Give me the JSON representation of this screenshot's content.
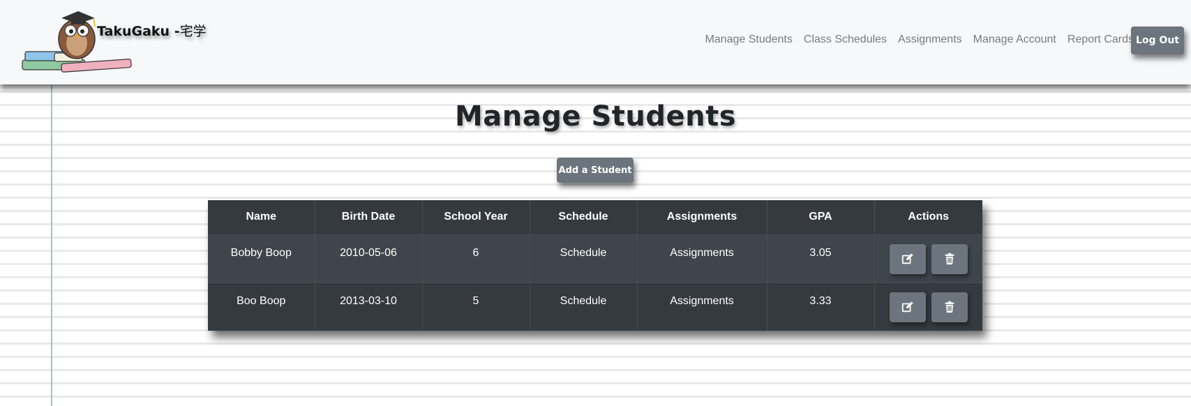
{
  "navbar": {
    "brand_main": "TakuGaku -",
    "brand_jp": "宅学",
    "links": [
      "Manage Students",
      "Class Schedules",
      "Assignments",
      "Manage Account",
      "Report Cards"
    ],
    "logout_label": "Log Out"
  },
  "page": {
    "title": "Manage Students",
    "add_button": "Add a Student"
  },
  "table": {
    "headers": [
      "Name",
      "Birth Date",
      "School Year",
      "Schedule",
      "Assignments",
      "GPA",
      "Actions"
    ],
    "rows": [
      {
        "name": "Bobby Boop",
        "birth_date": "2010-05-06",
        "school_year": "6",
        "schedule": "Schedule",
        "assignments": "Assignments",
        "gpa": "3.05"
      },
      {
        "name": "Boo Boop",
        "birth_date": "2013-03-10",
        "school_year": "5",
        "schedule": "Schedule",
        "assignments": "Assignments",
        "gpa": "3.33"
      }
    ]
  },
  "icons": {
    "logo": "owl-on-books-logo",
    "edit": "edit-icon",
    "delete": "trash-icon"
  },
  "colors": {
    "navbar_bg": "#f7f8f9",
    "button_bg": "#6c757d",
    "table_dark": "#343a40",
    "table_row_alt": "#3f454c",
    "margin_line": "#9cc4c8"
  }
}
